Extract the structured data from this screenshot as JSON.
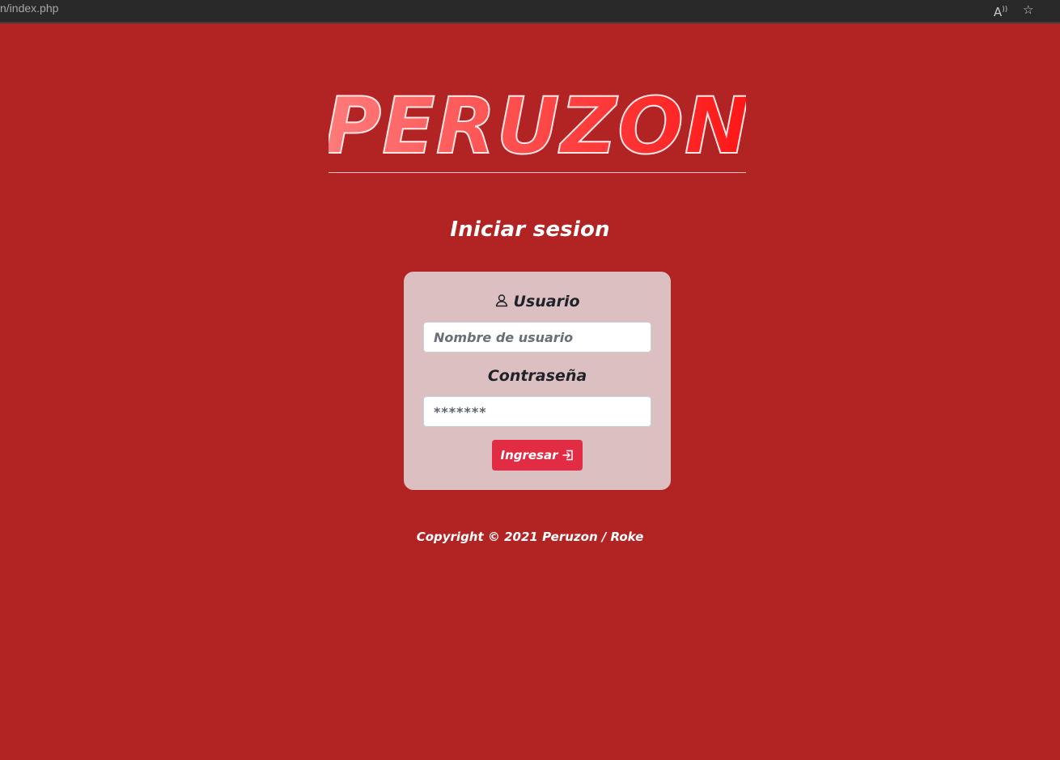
{
  "browser": {
    "url": "n/index.php",
    "read_aloud_icon": "read-aloud-icon",
    "favorite_icon": "add-favorite-icon"
  },
  "brand": {
    "name": "PERUZON",
    "colors": {
      "background": "#b22323",
      "logo_gradient_start": "#ff7777",
      "logo_gradient_end": "#ff1515",
      "card_background": "#dcbfc0",
      "button_background": "#e12c43"
    }
  },
  "login": {
    "title": "Iniciar sesion",
    "username_label": "Usuario",
    "username_placeholder": "Nombre de usuario",
    "password_label": "Contraseña",
    "password_value": "*******",
    "submit_label": "Ingresar",
    "user_icon": "user-icon",
    "enter_icon": "enter-icon"
  },
  "footer": {
    "copyright": "Copyright © 2021 Peruzon / Roke"
  }
}
